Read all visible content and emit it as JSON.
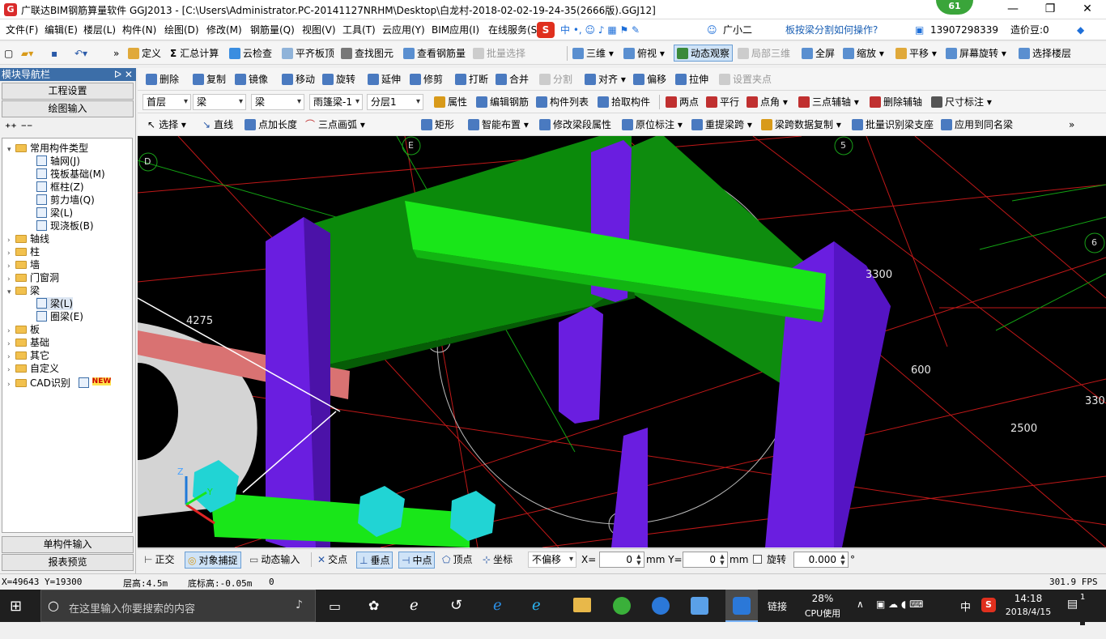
{
  "app": {
    "title": "广联达BIM钢筋算量软件 GGJ2013 - [C:\\Users\\Administrator.PC-20141127NRHM\\Desktop\\白龙村-2018-02-02-19-24-35(2666版).GGJ12]",
    "badge": "61"
  },
  "window_controls": {
    "min": "—",
    "max": "❐",
    "close": "✕"
  },
  "menu": {
    "items": [
      "文件(F)",
      "编辑(E)",
      "楼层(L)",
      "构件(N)",
      "绘图(D)",
      "修改(M)",
      "钢筋量(Q)",
      "视图(V)",
      "工具(T)",
      "云应用(Y)",
      "BIM应用(I)",
      "在线服务(S"
    ],
    "assistant": "广小二",
    "question": "板按梁分割如何操作?",
    "phone": "13907298339",
    "coins": "造价豆:0"
  },
  "toolbar1": {
    "items": [
      "定义",
      "汇总计算",
      "云检查",
      "平齐板顶",
      "查找图元",
      "查看钢筋量",
      "批量选择",
      "三维",
      "俯视",
      "动态观察",
      "局部三维",
      "全屏",
      "缩放",
      "平移",
      "屏幕旋转",
      "选择楼层"
    ]
  },
  "toolbar2": {
    "items": [
      "删除",
      "复制",
      "镜像",
      "移动",
      "旋转",
      "延伸",
      "修剪",
      "打断",
      "合并",
      "分割",
      "对齐",
      "偏移",
      "拉伸",
      "设置夹点"
    ]
  },
  "toolbar3": {
    "floor": "首层",
    "type1": "梁",
    "type2": "梁",
    "component": "雨篷梁-1",
    "layer": "分层1",
    "items": [
      "属性",
      "编辑钢筋",
      "构件列表",
      "拾取构件",
      "两点",
      "平行",
      "点角",
      "三点辅轴",
      "删除辅轴",
      "尺寸标注"
    ]
  },
  "toolbar4": {
    "items": [
      "选择",
      "直线",
      "点加长度",
      "三点画弧",
      "矩形",
      "智能布置",
      "修改梁段属性",
      "原位标注",
      "重提梁跨",
      "梁跨数据复制",
      "批量识别梁支座",
      "应用到同名梁"
    ]
  },
  "panel": {
    "header": "模块导航栏",
    "pin": "ᐅ ✕",
    "btn_project": "工程设置",
    "btn_draw": "绘图输入",
    "btn_single": "单构件输入",
    "btn_report": "报表预览",
    "tree": {
      "common": "常用构件类型",
      "common_items": [
        "轴网(J)",
        "筏板基础(M)",
        "框柱(Z)",
        "剪力墙(Q)",
        "梁(L)",
        "现浇板(B)"
      ],
      "folders": [
        "轴线",
        "柱",
        "墙",
        "门窗洞"
      ],
      "beam": "梁",
      "beam_items": [
        "梁(L)",
        "圈梁(E)"
      ],
      "folders2": [
        "板",
        "基础",
        "其它",
        "自定义",
        "CAD识别"
      ],
      "new_tag": "NEW"
    }
  },
  "viewport": {
    "dims": [
      "4275",
      "3300",
      "600",
      "2500",
      "330"
    ],
    "axes": [
      "D",
      "E",
      "5",
      "6"
    ],
    "axis_z": "Z",
    "axis_y": "Y"
  },
  "snapbar": {
    "items": [
      "正交",
      "对象捕捉",
      "动态输入",
      "交点",
      "垂点",
      "中点",
      "顶点",
      "坐标"
    ],
    "offset_mode": "不偏移",
    "x_label": "X=",
    "x_value": "0",
    "y_label": "mm  Y=",
    "y_value": "0",
    "mm": "mm",
    "rotate_label": "旋转",
    "rotate_value": "0.000",
    "degree": "°"
  },
  "status": {
    "coords": "X=49643 Y=19300",
    "floor_height": "层高:4.5m",
    "bottom_height": "底标高:-0.05m",
    "zero": "0",
    "fps": "301.9 FPS"
  },
  "taskbar": {
    "search_placeholder": "在这里输入你要搜索的内容",
    "link": "链接",
    "cpu_percent": "28%",
    "cpu_label": "CPU使用",
    "ime": "中",
    "time": "14:18",
    "date": "2018/4/15",
    "notif": "1"
  },
  "colors": {
    "purple_column": "#6a1ee0",
    "green_slab": "#0a8a0a",
    "bright_green_beam": "#19e619",
    "salmon_beam": "#d97070",
    "cyan_block": "#21d4d4",
    "panel_header": "#3c6ea8"
  }
}
